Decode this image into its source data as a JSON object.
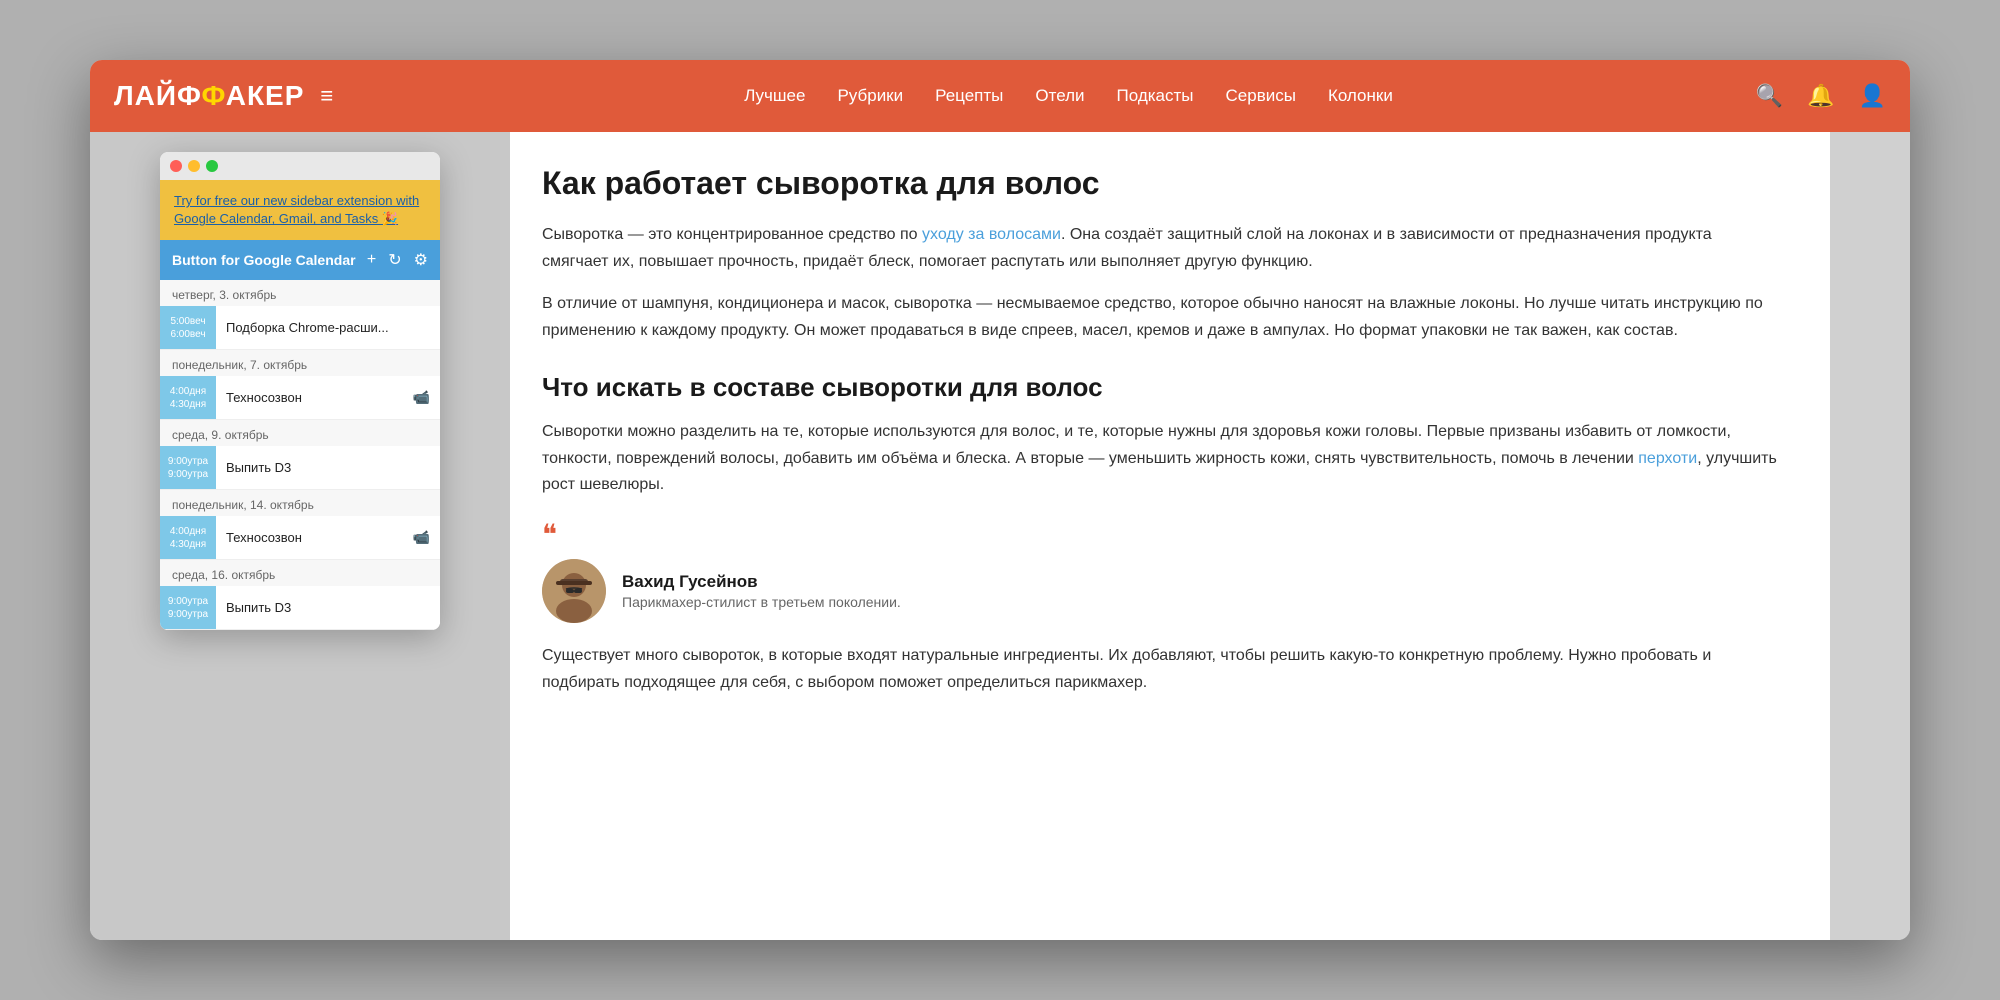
{
  "nav": {
    "logo": "ЛАЙФ",
    "logo_phi": "Ф",
    "logo_rest": "АКЕР",
    "links": [
      "Лучшее",
      "Рубрики",
      "Рецепты",
      "Отели",
      "Подкасты",
      "Сервисы",
      "Колонки"
    ],
    "hamburger": "≡"
  },
  "popup": {
    "promo_text": "Try for free our new sidebar extension with Google Calendar, Gmail, and Tasks 🎉",
    "cal_title": "Button for Google Calendar",
    "dates": [
      {
        "label": "четверг, 3. октябрь",
        "events": [
          {
            "time_from": "5:00веч",
            "time_to": "6:00веч",
            "title": "Подборка Chrome-расши...",
            "video": false
          }
        ]
      },
      {
        "label": "понедельник, 7. октябрь",
        "events": [
          {
            "time_from": "4:00дня",
            "time_to": "4:30дня",
            "title": "Техносозвон",
            "video": true
          }
        ]
      },
      {
        "label": "среда, 9. октябрь",
        "events": [
          {
            "time_from": "9:00утра",
            "time_to": "9:00утра",
            "title": "Выпить D3",
            "video": false
          }
        ]
      },
      {
        "label": "понедельник, 14. октябрь",
        "events": [
          {
            "time_from": "4:00дня",
            "time_to": "4:30дня",
            "title": "Техносозвон",
            "video": true
          }
        ]
      },
      {
        "label": "среда, 16. октябрь",
        "events": [
          {
            "time_from": "9:00утра",
            "time_to": "9:00утра",
            "title": "Выпить D3",
            "video": false
          }
        ]
      }
    ]
  },
  "article": {
    "h1": "Как работает сыворотка для волос",
    "p1": "Сыворотка — это концентрированное средство по уходу за волосами. Она создаёт защитный слой на локонах и в зависимости от предназначения продукта смягчает их, повышает прочность, придаёт блеск, помогает распутать или выполняет другую функцию.",
    "p1_link_text": "уходу за волосами",
    "p2": "В отличие от шампуня, кондиционера и масок, сыворотка — несмываемое средство, которое обычно наносят на влажные локоны. Но лучше читать инструкцию по применению к каждому продукту. Он может продаваться в виде спреев, масел, кремов и даже в ампулах. Но формат упаковки не так важен, как состав.",
    "h2": "Что искать в составе сыворотки для волос",
    "p3": "Сыворотки можно разделить на те, которые используются для волос, и те, которые нужны для здоровья кожи головы. Первые призваны избавить от ломкости, тонкости, повреждений волосы, добавить им объёма и блеска. А вторые — уменьшить жирность кожи, снять чувствительность, помочь в лечении перхоти, улучшить рост шевелюры.",
    "p3_link_text": "перхоти",
    "quote_mark": "❝",
    "author_name": "Вахид Гусейнов",
    "author_desc": "Парикмахер-стилист в третьем поколении.",
    "p4": "Существует много сывороток, в которые входят натуральные ингредиенты. Их добавляют, чтобы решить какую-то конкретную проблему. Нужно пробовать и подбирать подходящее для себя, с выбором поможет определиться парикмахер."
  }
}
